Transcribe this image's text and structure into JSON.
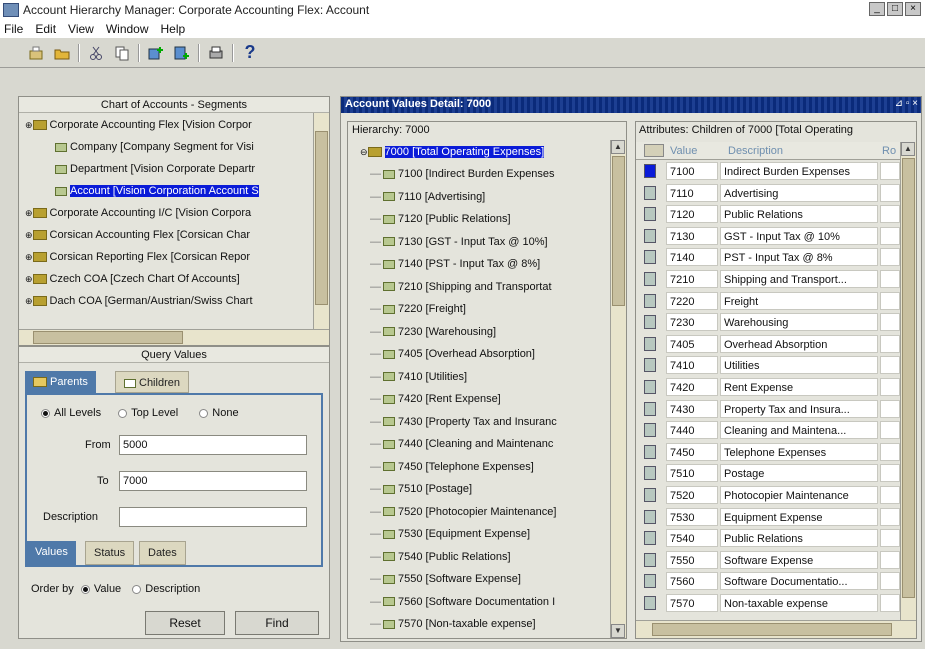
{
  "window": {
    "title": "Account Hierarchy Manager: Corporate Accounting Flex: Account",
    "btn_min": "_",
    "btn_max": "□",
    "btn_close": "×"
  },
  "menu": [
    "File",
    "Edit",
    "View",
    "Window",
    "Help"
  ],
  "toolbar": {
    "help": "?"
  },
  "left": {
    "coa_title": "Chart of Accounts - Segments",
    "tree": [
      {
        "label": "Corporate Accounting Flex  [Vision Corpor",
        "indent": 0,
        "type": "folder",
        "selected": false
      },
      {
        "label": "Company  [Company Segment for Visi",
        "indent": 1,
        "type": "leaf",
        "selected": false
      },
      {
        "label": "Department  [Vision Corporate Departr",
        "indent": 1,
        "type": "leaf",
        "selected": false
      },
      {
        "label": "Account  [Vision Corporation Account S",
        "indent": 1,
        "type": "leaf",
        "selected": true
      },
      {
        "label": "Corporate Accounting I/C  [Vision Corpora",
        "indent": 0,
        "type": "folder",
        "selected": false
      },
      {
        "label": "Corsican Accounting Flex  [Corsican Char",
        "indent": 0,
        "type": "folder",
        "selected": false
      },
      {
        "label": "Corsican Reporting Flex  [Corsican Repor",
        "indent": 0,
        "type": "folder",
        "selected": false
      },
      {
        "label": "Czech COA  [Czech Chart Of Accounts]",
        "indent": 0,
        "type": "folder",
        "selected": false
      },
      {
        "label": "Dach COA  [German/Austrian/Swiss Chart",
        "indent": 0,
        "type": "folder",
        "selected": false
      }
    ],
    "query_title": "Query Values",
    "tabs": {
      "parents": "Parents",
      "children": "Children"
    },
    "levels": {
      "all": "All Levels",
      "top": "Top Level",
      "none": "None",
      "selected": "all"
    },
    "from_label": "From",
    "from_value": "5000",
    "to_label": "To",
    "to_value": "7000",
    "desc_label": "Description",
    "desc_value": "",
    "subtabs": {
      "values": "Values",
      "status": "Status",
      "dates": "Dates"
    },
    "orderby_label": "Order by",
    "orderby_value": "Value",
    "orderby_desc": "Description",
    "reset": "Reset",
    "find": "Find"
  },
  "detail": {
    "title": "Account Values Detail: 7000",
    "hierarchy_label": "Hierarchy: 7000",
    "root": "7000  [Total Operating Expenses]",
    "children": [
      "7100  [Indirect Burden Expenses",
      "7110  [Advertising]",
      "7120  [Public Relations]",
      "7130  [GST - Input Tax @ 10%]",
      "7140  [PST - Input Tax @ 8%]",
      "7210  [Shipping and Transportat",
      "7220  [Freight]",
      "7230  [Warehousing]",
      "7405  [Overhead Absorption]",
      "7410  [Utilities]",
      "7420  [Rent Expense]",
      "7430  [Property Tax and Insuranc",
      "7440  [Cleaning and Maintenanc",
      "7450  [Telephone Expenses]",
      "7510  [Postage]",
      "7520  [Photocopier Maintenance]",
      "7530  [Equipment Expense]",
      "7540  [Public Relations]",
      "7550  [Software Expense]",
      "7560  [Software Documentation I",
      "7570  [Non-taxable expense]"
    ],
    "attributes_label": "Attributes: Children of 7000  [Total Operating",
    "col_value": "Value",
    "col_desc": "Description",
    "col_ro": "Ro",
    "rows": [
      {
        "value": "7100",
        "desc": "Indirect Burden Expenses"
      },
      {
        "value": "7110",
        "desc": "Advertising"
      },
      {
        "value": "7120",
        "desc": "Public Relations"
      },
      {
        "value": "7130",
        "desc": "GST - Input Tax @ 10%"
      },
      {
        "value": "7140",
        "desc": "PST - Input Tax @ 8%"
      },
      {
        "value": "7210",
        "desc": "Shipping and Transport..."
      },
      {
        "value": "7220",
        "desc": "Freight"
      },
      {
        "value": "7230",
        "desc": "Warehousing"
      },
      {
        "value": "7405",
        "desc": "Overhead Absorption"
      },
      {
        "value": "7410",
        "desc": "Utilities"
      },
      {
        "value": "7420",
        "desc": "Rent Expense"
      },
      {
        "value": "7430",
        "desc": "Property Tax and Insura..."
      },
      {
        "value": "7440",
        "desc": "Cleaning and Maintena..."
      },
      {
        "value": "7450",
        "desc": "Telephone Expenses"
      },
      {
        "value": "7510",
        "desc": "Postage"
      },
      {
        "value": "7520",
        "desc": "Photocopier Maintenance"
      },
      {
        "value": "7530",
        "desc": "Equipment Expense"
      },
      {
        "value": "7540",
        "desc": "Public Relations"
      },
      {
        "value": "7550",
        "desc": "Software Expense"
      },
      {
        "value": "7560",
        "desc": "Software Documentatio..."
      },
      {
        "value": "7570",
        "desc": "Non-taxable expense"
      }
    ]
  },
  "colors": {
    "selection": "#0a1bd8",
    "title_bar": "#0a2a7a",
    "active_tab": "#4f79a9"
  }
}
